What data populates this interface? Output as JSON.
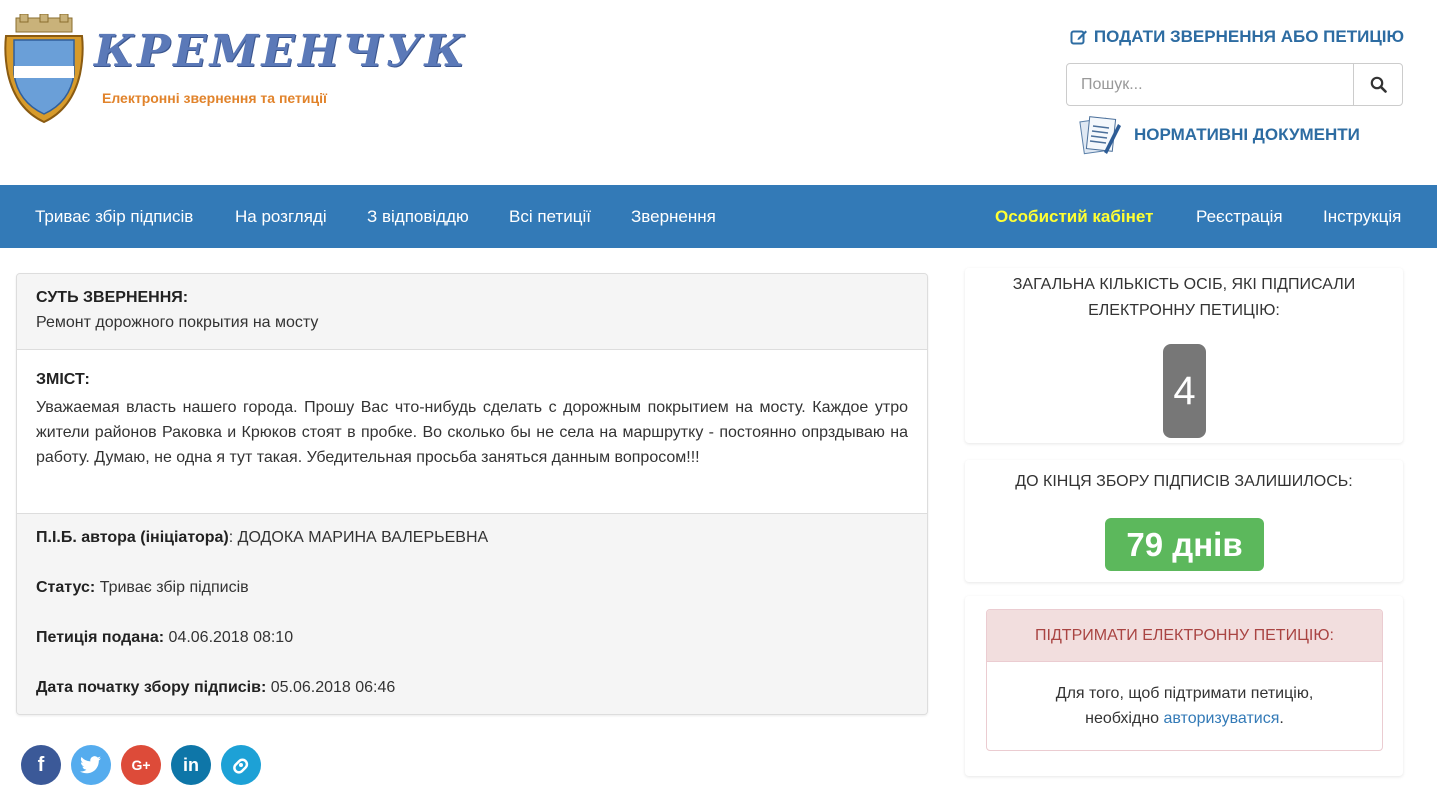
{
  "header": {
    "logo_title": "КРЕМЕНЧУК",
    "logo_subtitle": "Електронні звернення та петиції",
    "submit_link": "ПОДАТИ ЗВЕРНЕННЯ АБО ПЕТИЦІЮ",
    "search_placeholder": "Пошук...",
    "normative_docs": "НОРМАТИВНІ ДОКУМЕНТИ"
  },
  "nav": {
    "left": [
      "Триває збір підписів",
      "На розгляді",
      "З відповіддю",
      "Всі петиції",
      "Звернення"
    ],
    "right": [
      "Особистий кабінет",
      "Реєстрація",
      "Інструкція"
    ],
    "active": "Особистий кабінет",
    "active_color": "#ffff33",
    "bar_color": "#337ab7"
  },
  "petition": {
    "summary_label": "СУТЬ ЗВЕРНЕННЯ:",
    "summary_text": "Ремонт дорожного покрытия на мосту",
    "content_label": "ЗМІСТ:",
    "content_text": "Уважаемая власть нашего города. Прошу Вас что-нибудь сделать с дорожным покрытием на мосту. Каждое утро жители районов Раковка и Крюков стоят в пробке. Во сколько бы не села на маршрутку - постоянно опрздываю на работу. Думаю, не одна я тут такая. Убедительная просьба заняться данным вопросом!!!",
    "author_label": "П.І.Б. автора (ініціатора)",
    "author_value": ": ДОДОКА МАРИНА ВАЛЕРЬЕВНА",
    "status_label": "Статус:",
    "status_value": " Триває збір підписів",
    "submitted_label": "Петиція подана:",
    "submitted_value": " 04.06.2018 08:10",
    "start_label": "Дата початку збору підписів:",
    "start_value": " 05.06.2018 06:46"
  },
  "social": [
    {
      "icon": "facebook-icon",
      "glyph": "f",
      "color": "#3b5998"
    },
    {
      "icon": "twitter-icon",
      "glyph": "t",
      "color": "#55acee"
    },
    {
      "icon": "google-plus-icon",
      "glyph": "G+",
      "color": "#dd4b39"
    },
    {
      "icon": "linkedin-icon",
      "glyph": "in",
      "color": "#0e76a8"
    },
    {
      "icon": "share-link-icon",
      "glyph": "↻",
      "color": "#1da1d6"
    }
  ],
  "stats": {
    "signers_title": "ЗАГАЛЬНА КІЛЬКІСТЬ ОСІБ, ЯКІ ПІДПИСАЛИ ЕЛЕКТРОННУ ПЕТИЦІЮ:",
    "signers_count": "4",
    "remaining_title": "ДО КІНЦЯ ЗБОРУ ПІДПИСІВ ЗАЛИШИЛОСЬ:",
    "remaining_value": "79 днів"
  },
  "support": {
    "title": "ПІДТРИМАТИ ЕЛЕКТРОННУ ПЕТИЦІЮ:",
    "text_before": "Для того, щоб підтримати петицію,",
    "text_line2": "необхідно ",
    "link": "авторизуватися",
    "text_after": "."
  }
}
